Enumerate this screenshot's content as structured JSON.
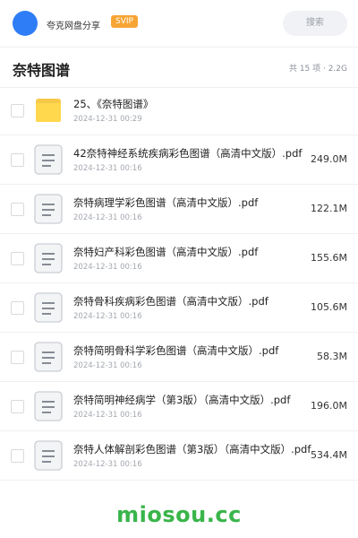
{
  "header": {
    "username": "夸克网盘分享",
    "badge": "SVIP",
    "search_placeholder": "搜索"
  },
  "folder": {
    "title": "奈特图谱",
    "summary": "共 15 项 · 2.2G"
  },
  "files": [
    {
      "type": "folder",
      "name": "25、《奈特图谱》",
      "date": "2024-12-31 00:29",
      "size": ""
    },
    {
      "type": "document",
      "name": "42奈特神经系统疾病彩色图谱（高清中文版）.pdf",
      "date": "2024-12-31 00:16",
      "size": "249.0M"
    },
    {
      "type": "document",
      "name": "奈特病理学彩色图谱（高清中文版）.pdf",
      "date": "2024-12-31 00:16",
      "size": "122.1M"
    },
    {
      "type": "document",
      "name": "奈特妇产科彩色图谱（高清中文版）.pdf",
      "date": "2024-12-31 00:16",
      "size": "155.6M"
    },
    {
      "type": "document",
      "name": "奈特骨科疾病彩色图谱（高清中文版）.pdf",
      "date": "2024-12-31 00:16",
      "size": "105.6M"
    },
    {
      "type": "document",
      "name": "奈特简明骨科学彩色图谱（高清中文版）.pdf",
      "date": "2024-12-31 00:16",
      "size": "58.3M"
    },
    {
      "type": "document",
      "name": "奈特简明神经病学（第3版）（高清中文版）.pdf",
      "date": "2024-12-31 00:16",
      "size": "196.0M"
    },
    {
      "type": "document",
      "name": "奈特人体解剖彩色图谱（第3版）（高清中文版）.pdf",
      "date": "2024-12-31 00:16",
      "size": "534.4M"
    }
  ],
  "watermark": "miosou.cc",
  "colors": {
    "accent": "#2f7df6",
    "svip": "#f7a535",
    "watermark": "#39b54a"
  }
}
